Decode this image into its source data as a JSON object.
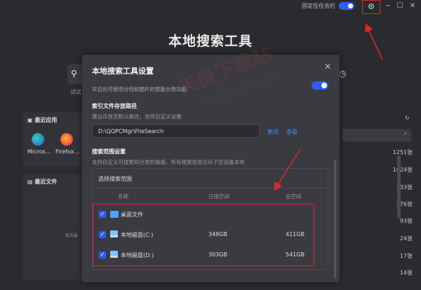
{
  "titlebar": {
    "pin_label": "固定在任务栏",
    "settings_icon": "gear-icon",
    "minimize_glyph": "−",
    "maximize_glyph": "☐",
    "close_glyph": "✕"
  },
  "app": {
    "title": "本地搜索工具",
    "try_text": "试试",
    "recent_apps_title": "最近应用",
    "recent_files_title": "最近文件",
    "apps": [
      {
        "label": "Micros..."
      },
      {
        "label": "Firefox..."
      }
    ],
    "empty_text": "暂无最",
    "counts": [
      "1251张",
      "1024张",
      "333张",
      "276张",
      "93张",
      "24张",
      "17张",
      "14张"
    ]
  },
  "settings": {
    "title": "本地搜索工具设置",
    "close_glyph": "✕",
    "smart_classify_text": "开启后可使用分档和图片的智能分类功能",
    "index_path_title": "索引文件存放路径",
    "index_path_sub": "建议存放至默认路径，支持自定义设置",
    "index_path_value": "D:\\QQPCMgr\\FileSearch",
    "change_label": "更改",
    "view_label": "查看",
    "search_range_title": "搜索范围设置",
    "search_range_sub": "支持自定义可搜索和分类的磁盘，所有搜索信息仅存于您设备本地",
    "select_range_label": "选择搜索范围",
    "columns": {
      "name": "名称",
      "used": "已用空间",
      "total": "总空间"
    },
    "rows": [
      {
        "name": "桌面文件",
        "used": "",
        "total": "",
        "checked": true
      },
      {
        "name": "本地磁盘(C:)",
        "used": "348GB",
        "total": "411GB",
        "checked": true
      },
      {
        "name": "本地磁盘(D:)",
        "used": "303GB",
        "total": "541GB",
        "checked": true
      }
    ]
  },
  "watermark": {
    "text": "天极下载站",
    "url": "mydown.yesky.com"
  },
  "colors": {
    "accent": "#2f5bff",
    "highlight": "#e0262a",
    "link": "#3d8bff"
  }
}
